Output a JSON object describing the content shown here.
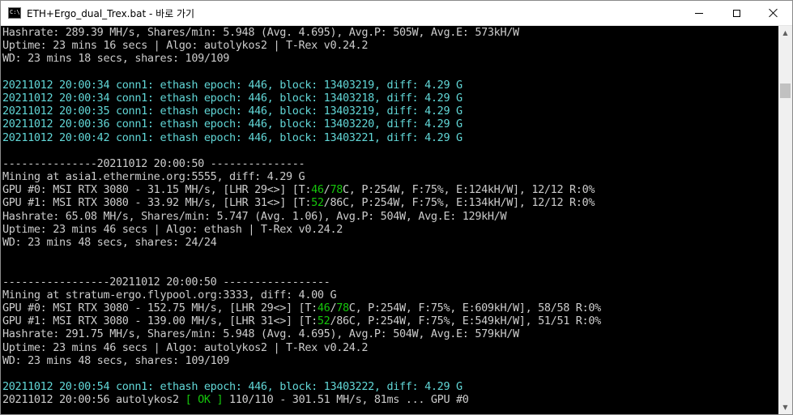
{
  "window": {
    "title": "ETH+Ergo_dual_Trex.bat - 바로 가기",
    "icon": "console-icon",
    "icon_text": "C:\\."
  },
  "console": {
    "lines": [
      {
        "color": "default",
        "segments": [
          {
            "text": "Hashrate: 289.39 MH/s, Shares/min: 5.948 (Avg. 4.695), Avg.P: 505W, Avg.E: 573kH/W",
            "color": "default"
          }
        ]
      },
      {
        "color": "default",
        "segments": [
          {
            "text": "Uptime: 23 mins 16 secs | Algo: autolykos2 | T-Rex v0.24.2",
            "color": "default"
          }
        ]
      },
      {
        "color": "default",
        "segments": [
          {
            "text": "WD: 23 mins 18 secs, shares: 109/109",
            "color": "default"
          }
        ]
      },
      {
        "color": "default",
        "segments": [
          {
            "text": "",
            "color": "default"
          }
        ]
      },
      {
        "color": "default",
        "segments": [
          {
            "text": "20211012 20:00:34 conn1: ethash epoch: 446, block: 13403219, diff: 4.29 G",
            "color": "teal"
          }
        ]
      },
      {
        "color": "default",
        "segments": [
          {
            "text": "20211012 20:00:34 conn1: ethash epoch: 446, block: 13403218, diff: 4.29 G",
            "color": "teal"
          }
        ]
      },
      {
        "color": "default",
        "segments": [
          {
            "text": "20211012 20:00:35 conn1: ethash epoch: 446, block: 13403219, diff: 4.29 G",
            "color": "teal"
          }
        ]
      },
      {
        "color": "default",
        "segments": [
          {
            "text": "20211012 20:00:36 conn1: ethash epoch: 446, block: 13403220, diff: 4.29 G",
            "color": "teal"
          }
        ]
      },
      {
        "color": "default",
        "segments": [
          {
            "text": "20211012 20:00:42 conn1: ethash epoch: 446, block: 13403221, diff: 4.29 G",
            "color": "teal"
          }
        ]
      },
      {
        "color": "default",
        "segments": [
          {
            "text": "",
            "color": "default"
          }
        ]
      },
      {
        "color": "default",
        "segments": [
          {
            "text": "---------------20211012 20:00:50 ---------------",
            "color": "default"
          }
        ]
      },
      {
        "color": "default",
        "segments": [
          {
            "text": "Mining at asia1.ethermine.org:5555, diff: 4.29 G",
            "color": "default"
          }
        ]
      },
      {
        "color": "default",
        "segments": [
          {
            "text": "GPU #0: MSI RTX 3080 - 31.15 MH/s, [LHR 29<>] [T:",
            "color": "default"
          },
          {
            "text": "46",
            "color": "green"
          },
          {
            "text": "/",
            "color": "default"
          },
          {
            "text": "78",
            "color": "green"
          },
          {
            "text": "C, P:254W, F:75%, E:124kH/W], 12/12 R:0%",
            "color": "default"
          }
        ]
      },
      {
        "color": "default",
        "segments": [
          {
            "text": "GPU #1: MSI RTX 3080 - 33.92 MH/s, [LHR 31<>] [T:",
            "color": "default"
          },
          {
            "text": "52",
            "color": "green"
          },
          {
            "text": "/86C, P:254W, F:75%, E:134kH/W], 12/12 R:0%",
            "color": "default"
          }
        ]
      },
      {
        "color": "default",
        "segments": [
          {
            "text": "Hashrate: 65.08 MH/s, Shares/min: 5.747 (Avg. 1.06), Avg.P: 504W, Avg.E: 129kH/W",
            "color": "default"
          }
        ]
      },
      {
        "color": "default",
        "segments": [
          {
            "text": "Uptime: 23 mins 46 secs | Algo: ethash | T-Rex v0.24.2",
            "color": "default"
          }
        ]
      },
      {
        "color": "default",
        "segments": [
          {
            "text": "WD: 23 mins 48 secs, shares: 24/24",
            "color": "default"
          }
        ]
      },
      {
        "color": "default",
        "segments": [
          {
            "text": "",
            "color": "default"
          }
        ]
      },
      {
        "color": "default",
        "segments": [
          {
            "text": "",
            "color": "default"
          }
        ]
      },
      {
        "color": "default",
        "segments": [
          {
            "text": "-----------------20211012 20:00:50 -----------------",
            "color": "default"
          }
        ]
      },
      {
        "color": "default",
        "segments": [
          {
            "text": "Mining at stratum-ergo.flypool.org:3333, diff: 4.00 G",
            "color": "default"
          }
        ]
      },
      {
        "color": "default",
        "segments": [
          {
            "text": "GPU #0: MSI RTX 3080 - 152.75 MH/s, [LHR 29<>] [T:",
            "color": "default"
          },
          {
            "text": "46",
            "color": "green"
          },
          {
            "text": "/",
            "color": "default"
          },
          {
            "text": "78",
            "color": "green"
          },
          {
            "text": "C, P:254W, F:75%, E:609kH/W], 58/58 R:0%",
            "color": "default"
          }
        ]
      },
      {
        "color": "default",
        "segments": [
          {
            "text": "GPU #1: MSI RTX 3080 - 139.00 MH/s, [LHR 31<>] [T:",
            "color": "default"
          },
          {
            "text": "52",
            "color": "green"
          },
          {
            "text": "/86C, P:254W, F:75%, E:549kH/W], 51/51 R:0%",
            "color": "default"
          }
        ]
      },
      {
        "color": "default",
        "segments": [
          {
            "text": "Hashrate: 291.75 MH/s, Shares/min: 5.948 (Avg. 4.695), Avg.P: 504W, Avg.E: 579kH/W",
            "color": "default"
          }
        ]
      },
      {
        "color": "default",
        "segments": [
          {
            "text": "Uptime: 23 mins 46 secs | Algo: autolykos2 | T-Rex v0.24.2",
            "color": "default"
          }
        ]
      },
      {
        "color": "default",
        "segments": [
          {
            "text": "WD: 23 mins 48 secs, shares: 109/109",
            "color": "default"
          }
        ]
      },
      {
        "color": "default",
        "segments": [
          {
            "text": "",
            "color": "default"
          }
        ]
      },
      {
        "color": "default",
        "segments": [
          {
            "text": "20211012 20:00:54 conn1: ethash epoch: 446, block: 13403222, diff: 4.29 G",
            "color": "teal"
          }
        ]
      },
      {
        "color": "default",
        "segments": [
          {
            "text": "20211012 20:00:56 autolykos2 ",
            "color": "default"
          },
          {
            "text": "[ OK ]",
            "color": "green"
          },
          {
            "text": " 110/110 - 301.51 MH/s, 81ms ... GPU #0",
            "color": "default"
          }
        ]
      }
    ]
  },
  "colors": {
    "default": "#cccccc",
    "teal": "#61d6d6",
    "green": "#16c60c",
    "background": "#000000"
  },
  "scrollbar": {
    "up_arrow": "▲",
    "down_arrow": "▼"
  }
}
